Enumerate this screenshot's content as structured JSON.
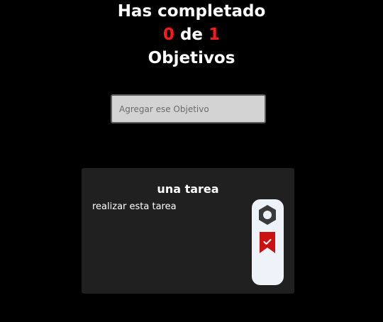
{
  "header": {
    "line1": "Has completado",
    "completed_count": "0",
    "connector": "de",
    "total_count": "1",
    "line3": "Objetivos"
  },
  "new_goal_input": {
    "placeholder": "Agregar ese Objetivo",
    "value": ""
  },
  "tasks": [
    {
      "title": "una tarea",
      "description": "realizar esta tarea",
      "actions": {
        "delete_icon": "hexagon-nut-icon",
        "complete_icon": "bookmark-check-icon"
      }
    }
  ],
  "colors": {
    "background": "#000000",
    "accent_red": "#ff1a1a",
    "card_bg": "#202020",
    "input_bg": "#d3d3d3",
    "action_panel_bg": "#eef3fa",
    "delete_icon": "#3a3a3a",
    "complete_icon": "#cc1111"
  }
}
